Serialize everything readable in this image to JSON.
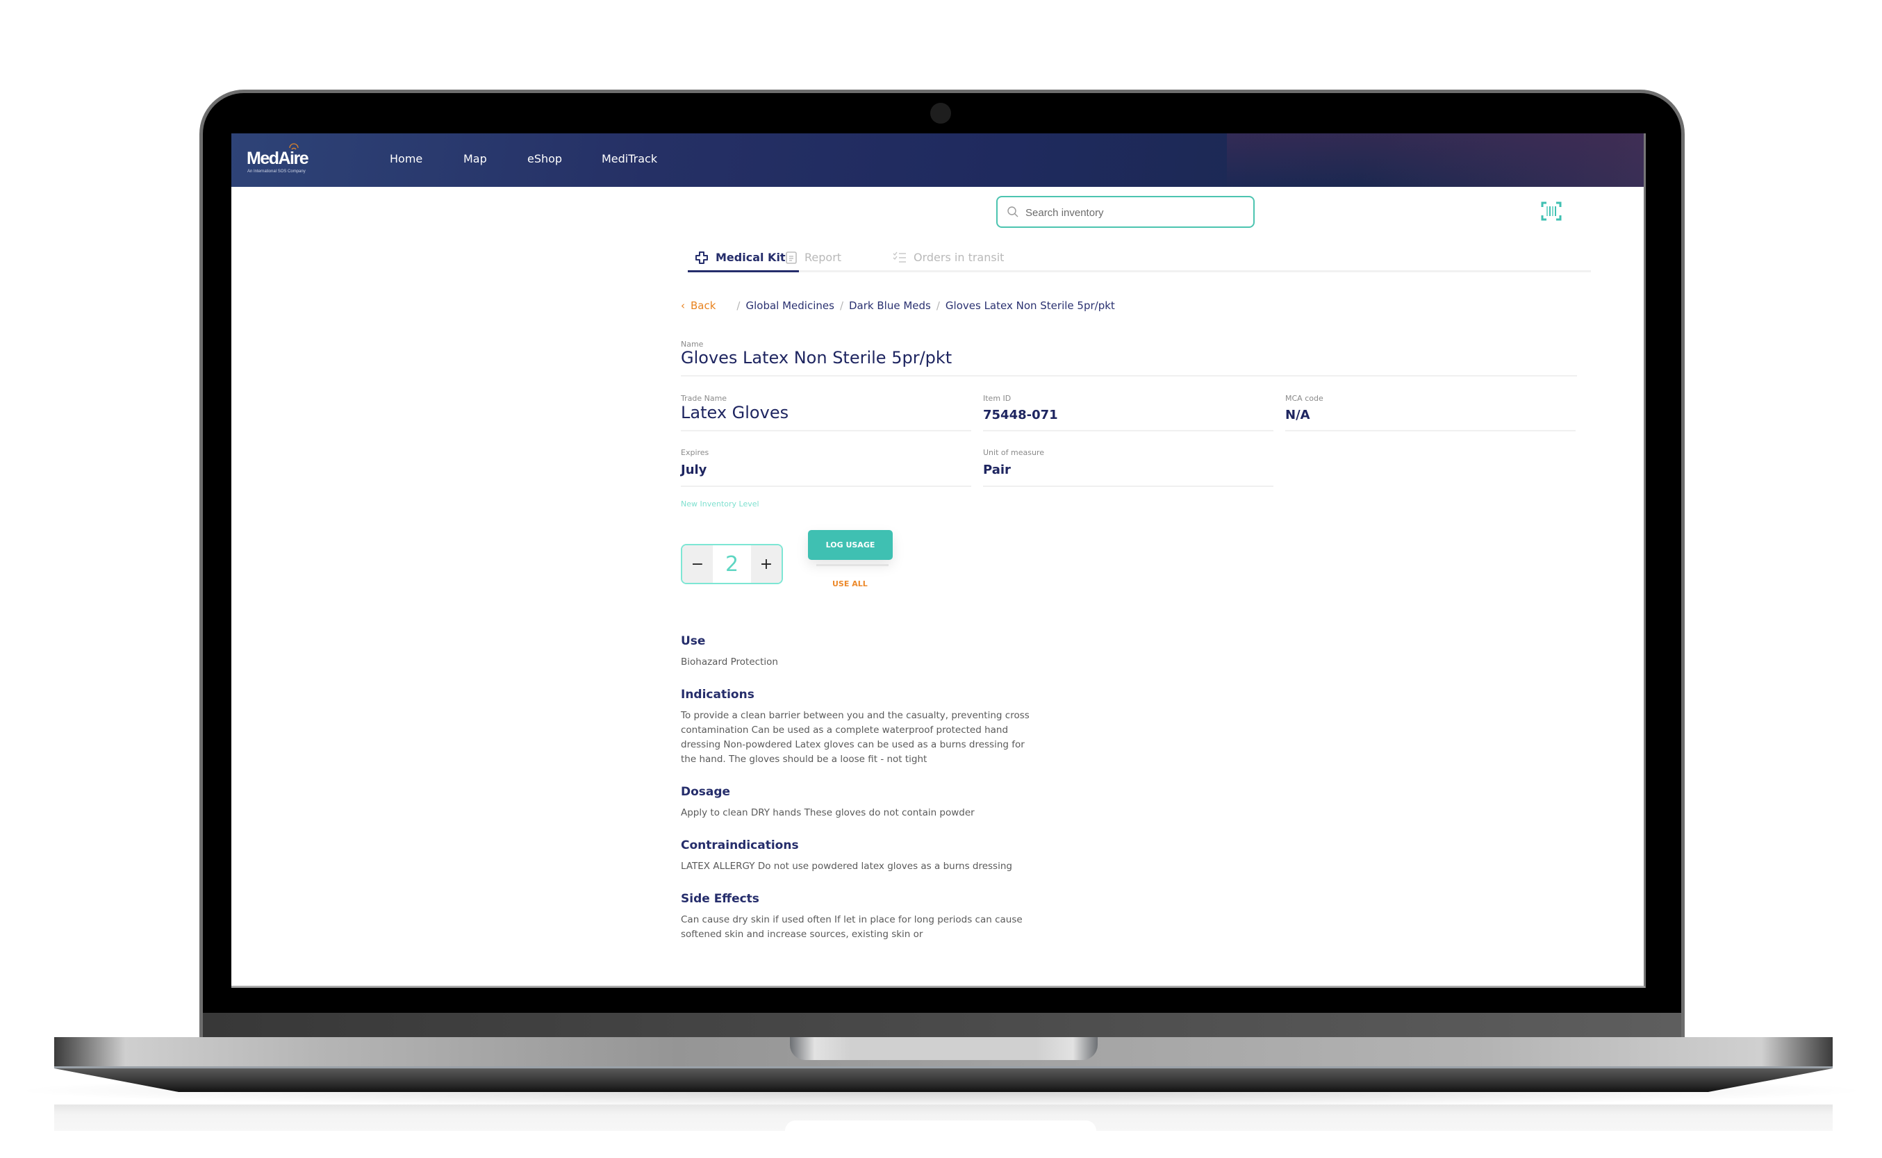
{
  "app": {
    "brand": "MedAire",
    "brand_tagline": "An International SOS Company",
    "colors": {
      "navbar": "#1f2a5e",
      "accent_teal": "#3fc0b2",
      "accent_orange": "#e8821e",
      "heading_navy": "#252d6b"
    }
  },
  "nav": {
    "items": [
      {
        "label": "Home"
      },
      {
        "label": "Map"
      },
      {
        "label": "eShop"
      },
      {
        "label": "MediTrack"
      }
    ]
  },
  "search": {
    "placeholder": "Search inventory",
    "value": "",
    "icon": "search-icon"
  },
  "scanner": {
    "icon": "barcode-scan-icon"
  },
  "tabs": [
    {
      "label": "Medical Kit",
      "icon": "medical-cross-icon",
      "active": true
    },
    {
      "label": "Report",
      "icon": "clipboard-icon",
      "active": false
    },
    {
      "label": "Orders in transit",
      "icon": "checklist-icon",
      "active": false
    }
  ],
  "breadcrumb": {
    "back_label": "Back",
    "items": [
      "Global Medicines",
      "Dark Blue Meds",
      "Gloves Latex Non Sterile 5pr/pkt"
    ]
  },
  "item": {
    "name_label": "Name",
    "name": "Gloves Latex Non Sterile 5pr/pkt",
    "trade_name_label": "Trade Name",
    "trade_name": "Latex Gloves",
    "item_id_label": "Item ID",
    "item_id": "75448-071",
    "mca_code_label": "MCA code",
    "mca_code": "N/A",
    "expires_label": "Expires",
    "expires": "July",
    "unit_label": "Unit of measure",
    "unit": "Pair"
  },
  "inventory": {
    "label": "New Inventory Level",
    "value": "2",
    "decrement": "−",
    "increment": "+",
    "log_usage_label": "LOG USAGE",
    "use_all_label": "USE ALL"
  },
  "sections": [
    {
      "title": "Use",
      "body": "Biohazard Protection"
    },
    {
      "title": "Indications",
      "body": "To provide a clean barrier between you and the casualty, preventing cross contamination Can be used as a complete waterproof protected hand dressing Non-powdered Latex gloves can be used as a burns dressing for the hand. The gloves should be a loose fit - not tight"
    },
    {
      "title": "Dosage",
      "body": "Apply to clean DRY hands These gloves do not contain powder"
    },
    {
      "title": "Contraindications",
      "body": "LATEX ALLERGY Do not use powdered latex gloves as a burns dressing"
    },
    {
      "title": "Side Effects",
      "body": "Can cause dry skin if used often If let in place for long periods can cause softened skin and increase sources, existing skin or"
    }
  ]
}
